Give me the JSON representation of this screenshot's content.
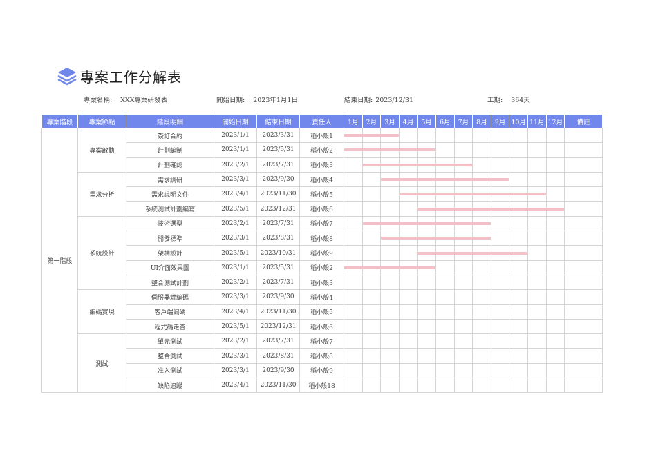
{
  "title": "專案工作分解表",
  "meta": {
    "project_name_label": "專案名稱:",
    "project_name": "XXX專案研發表",
    "start_label": "開始日期:",
    "start": "2023年1月1日",
    "end_label": "結束日期:",
    "end": "2023/12/31",
    "duration_label": "工期:",
    "duration": "364天"
  },
  "headers": [
    "專案階段",
    "專案節點",
    "階段明細",
    "開始日期",
    "結束日期",
    "責任人",
    "1月",
    "2月",
    "3月",
    "4月",
    "5月",
    "6月",
    "7月",
    "8月",
    "9月",
    "10月",
    "11月",
    "12月",
    "備註"
  ],
  "stage": "第一階段",
  "nodes": [
    {
      "name": "專案啟動",
      "rows": [
        {
          "detail": "簽訂合約",
          "start": "2023/1/1",
          "end": "2023/3/31",
          "owner": "稻小殼1",
          "from": 1,
          "to": 3
        },
        {
          "detail": "計劃編制",
          "start": "2023/1/1",
          "end": "2023/5/31",
          "owner": "稻小殼2",
          "from": 1,
          "to": 5
        },
        {
          "detail": "計劃確認",
          "start": "2023/2/1",
          "end": "2023/7/31",
          "owner": "稻小殼3",
          "from": 2,
          "to": 7
        }
      ]
    },
    {
      "name": "需求分析",
      "rows": [
        {
          "detail": "需求調研",
          "start": "2023/3/1",
          "end": "2023/9/30",
          "owner": "稻小殼4",
          "from": 3,
          "to": 9
        },
        {
          "detail": "需求說明文件",
          "start": "2023/4/1",
          "end": "2023/11/30",
          "owner": "稻小殼5",
          "from": 4,
          "to": 11
        },
        {
          "detail": "系統測試計劃編寫",
          "start": "2023/5/1",
          "end": "2023/12/31",
          "owner": "稻小殼6",
          "from": 5,
          "to": 12
        }
      ]
    },
    {
      "name": "系統設計",
      "rows": [
        {
          "detail": "技術選型",
          "start": "2023/2/1",
          "end": "2023/7/31",
          "owner": "稻小殼7",
          "from": 2,
          "to": 8
        },
        {
          "detail": "開發標準",
          "start": "2023/3/1",
          "end": "2023/8/31",
          "owner": "稻小殼8",
          "from": 3,
          "to": 8
        },
        {
          "detail": "架構設計",
          "start": "2023/5/1",
          "end": "2023/10/31",
          "owner": "稻小殼9",
          "from": 5,
          "to": 10
        },
        {
          "detail": "UI介面效果圖",
          "start": "2023/1/1",
          "end": "2023/5/31",
          "owner": "稻小殼2",
          "from": 1,
          "to": 5
        },
        {
          "detail": "整合測試計劃",
          "start": "2023/2/1",
          "end": "2023/7/31",
          "owner": "稻小殼3",
          "from": null,
          "to": null
        }
      ]
    },
    {
      "name": "編碼實現",
      "rows": [
        {
          "detail": "伺服器端編碼",
          "start": "2023/3/1",
          "end": "2023/9/30",
          "owner": "稻小殼4",
          "from": null,
          "to": null
        },
        {
          "detail": "客戶端編碼",
          "start": "2023/4/1",
          "end": "2023/11/30",
          "owner": "稻小殼5",
          "from": null,
          "to": null
        },
        {
          "detail": "程式碼走查",
          "start": "2023/5/1",
          "end": "2023/12/31",
          "owner": "稻小殼6",
          "from": null,
          "to": null
        }
      ]
    },
    {
      "name": "測試",
      "rows": [
        {
          "detail": "單元測試",
          "start": "2023/2/1",
          "end": "2023/7/31",
          "owner": "稻小殼7",
          "from": null,
          "to": null
        },
        {
          "detail": "整合測試",
          "start": "2023/3/1",
          "end": "2023/8/31",
          "owner": "稻小殼8",
          "from": null,
          "to": null
        },
        {
          "detail": "准入測試",
          "start": "2023/3/1",
          "end": "2023/9/30",
          "owner": "稻小殼9",
          "from": null,
          "to": null
        },
        {
          "detail": "缺陷追蹤",
          "start": "2023/4/1",
          "end": "2023/11/30",
          "owner": "稻小殼18",
          "from": null,
          "to": null
        }
      ]
    }
  ],
  "colors": {
    "header_bg": "#7287ec",
    "bar": "#f4c0c8",
    "icon": "#6f86ea"
  }
}
